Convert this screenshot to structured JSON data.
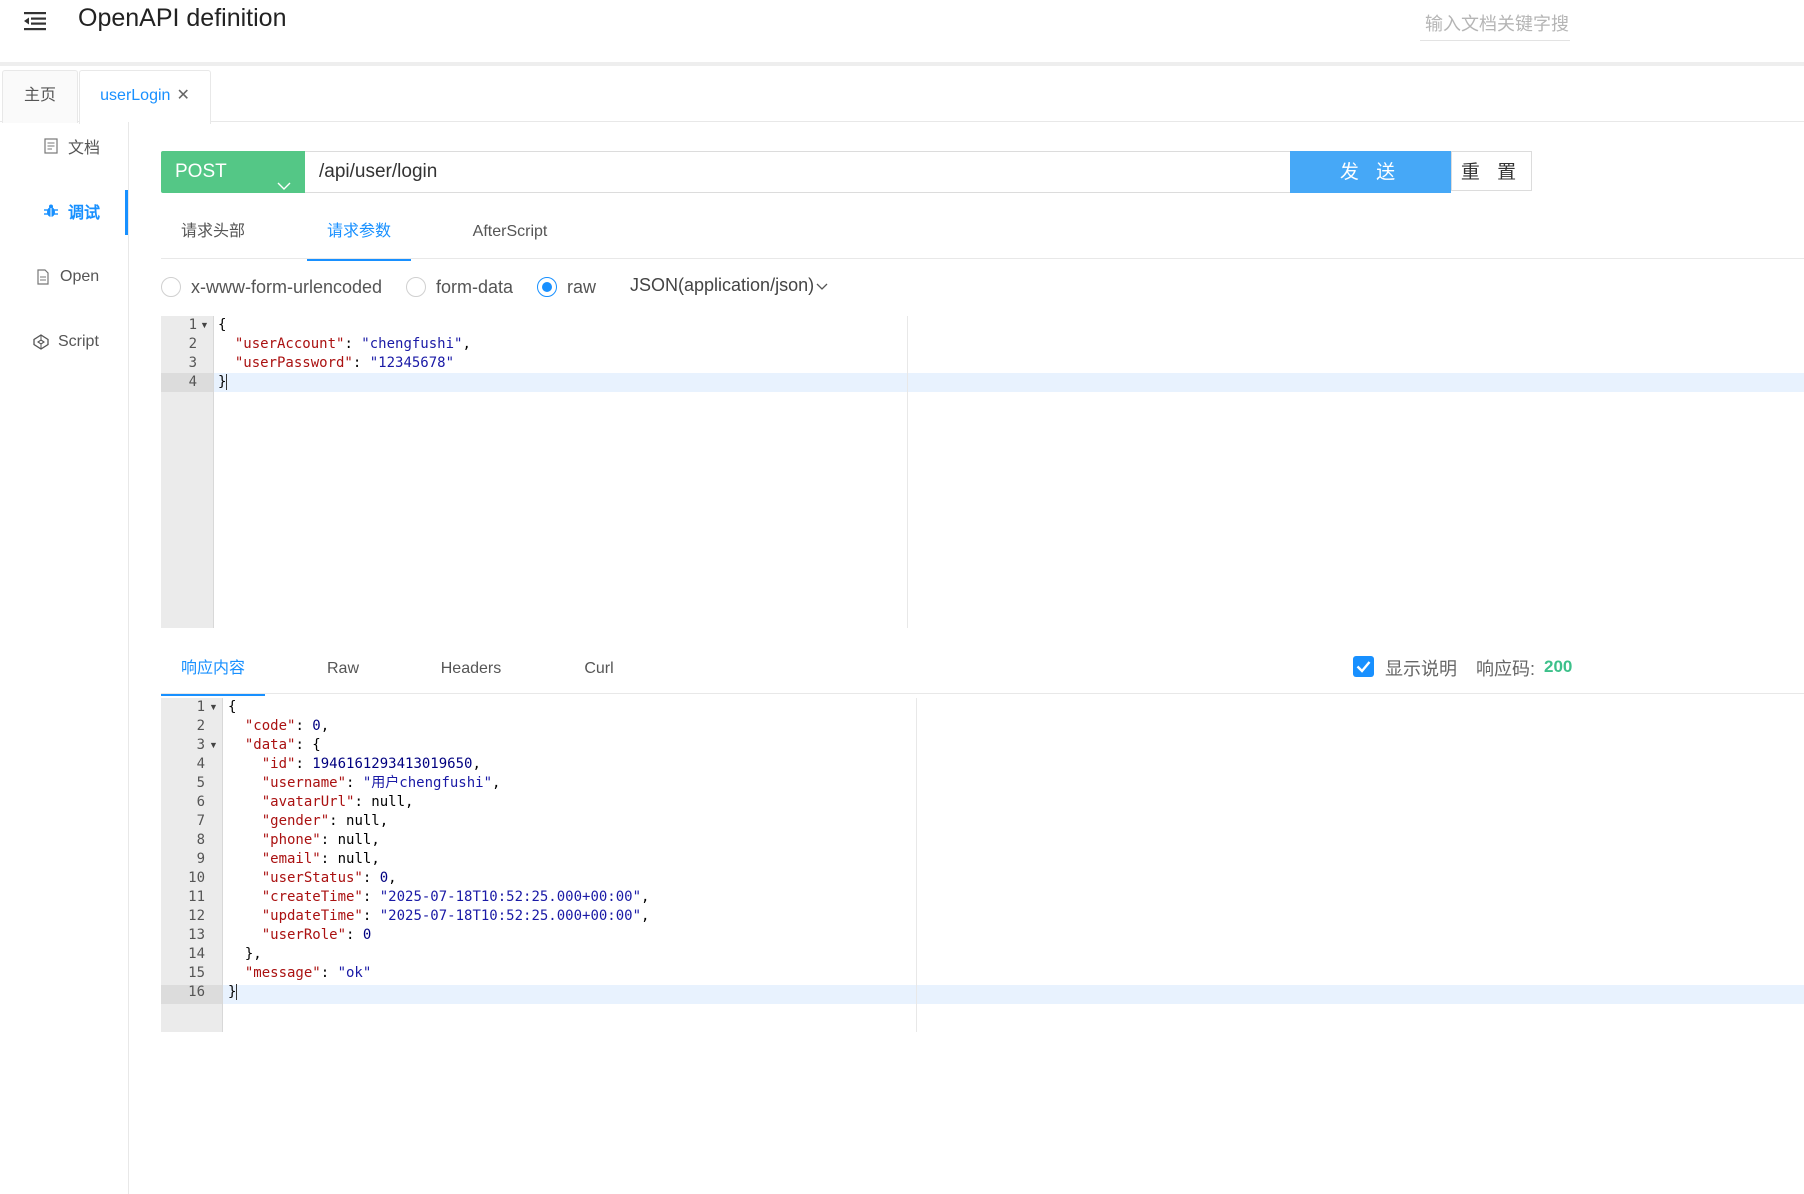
{
  "header": {
    "title": "OpenAPI definition",
    "search_placeholder": "输入文档关键字搜"
  },
  "tabs": [
    {
      "label": "主页"
    },
    {
      "label": "userLogin"
    }
  ],
  "leftnav": {
    "items": [
      {
        "label": "文档",
        "icon": "document-icon"
      },
      {
        "label": "调试",
        "icon": "bug-icon",
        "active": true
      },
      {
        "label": "Open",
        "icon": "file-icon"
      },
      {
        "label": "Script",
        "icon": "codepen-icon"
      }
    ]
  },
  "request": {
    "method": "POST",
    "url": "/api/user/login",
    "send_label": "发 送",
    "reset_label": "重 置",
    "send_color": "#46a8f7",
    "method_color": "#54c786"
  },
  "request_tabs": [
    {
      "label": "请求头部"
    },
    {
      "label": "请求参数",
      "active": true
    },
    {
      "label": "AfterScript"
    }
  ],
  "body_types": [
    {
      "label": "x-www-form-urlencoded",
      "checked": false
    },
    {
      "label": "form-data",
      "checked": false
    },
    {
      "label": "raw",
      "checked": true
    }
  ],
  "content_type": "JSON(application/json)",
  "request_body": {
    "line_numbers": [
      "1",
      "2",
      "3",
      "4"
    ],
    "active_line": 4
  },
  "response_tabs": [
    {
      "label": "响应内容",
      "active": true
    },
    {
      "label": "Raw"
    },
    {
      "label": "Headers"
    },
    {
      "label": "Curl"
    }
  ],
  "response_meta": {
    "show_desc_label": "显示说明",
    "show_desc_checked": true,
    "status_label": "响应码:",
    "status_code": "200"
  },
  "response_body": {
    "line_numbers": [
      "1",
      "2",
      "3",
      "4",
      "5",
      "6",
      "7",
      "8",
      "9",
      "10",
      "11",
      "12",
      "13",
      "14",
      "15",
      "16"
    ],
    "active_line": 16
  },
  "tokens": {
    "req": {
      "open": "{",
      "k_account": "\"userAccount\"",
      "v_account": "\"chengfushi\"",
      "k_password": "\"userPassword\"",
      "v_password": "\"12345678\"",
      "close": "}"
    },
    "resp": {
      "k_code": "\"code\"",
      "v_code": "0",
      "k_data": "\"data\"",
      "k_id": "\"id\"",
      "v_id": "1946161293413019650",
      "k_username": "\"username\"",
      "v_username": "\"用户chengfushi\"",
      "k_avatar": "\"avatarUrl\"",
      "v_null": "null",
      "k_gender": "\"gender\"",
      "k_phone": "\"phone\"",
      "k_email": "\"email\"",
      "k_status": "\"userStatus\"",
      "v_status": "0",
      "k_create": "\"createTime\"",
      "v_create": "\"2025-07-18T10:52:25.000+00:00\"",
      "k_update": "\"updateTime\"",
      "v_update": "\"2025-07-18T10:52:25.000+00:00\"",
      "k_role": "\"userRole\"",
      "v_role": "0",
      "k_message": "\"message\"",
      "v_message": "\"ok\""
    }
  }
}
